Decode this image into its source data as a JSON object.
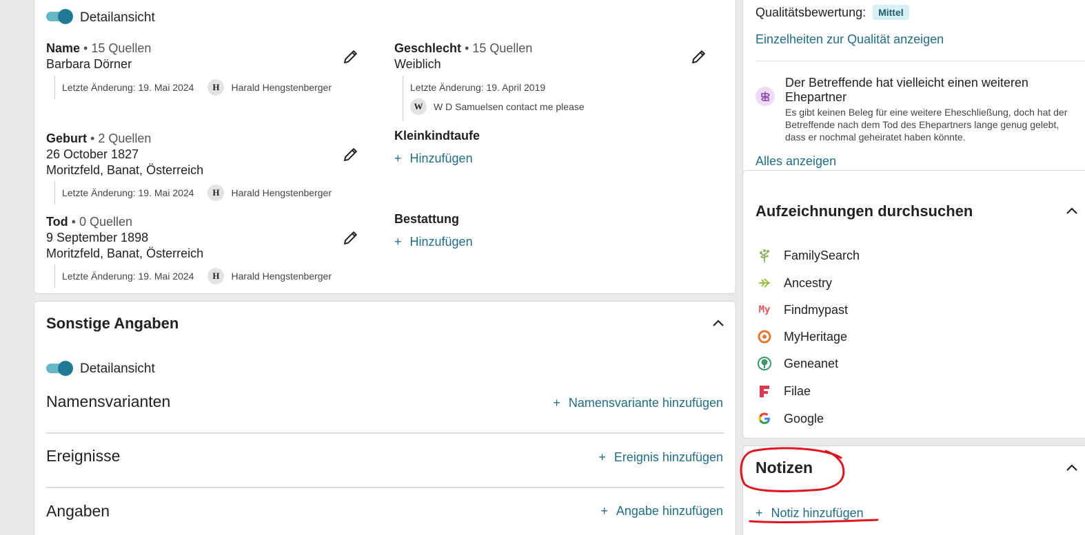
{
  "details": {
    "toggle_label": "Detailansicht",
    "name": {
      "label": "Name",
      "sources": "• 15 Quellen",
      "value": "Barbara Dörner",
      "changed": "Letzte Änderung: 19. Mai 2024",
      "avatar": "H",
      "user": "Harald Hengstenberger"
    },
    "sex": {
      "label": "Geschlecht",
      "sources": "• 15 Quellen",
      "value": "Weiblich",
      "changed": "Letzte Änderung: 19. April 2019",
      "avatar": "W",
      "user": "W D Samuelsen contact me please"
    },
    "birth": {
      "label": "Geburt",
      "sources": "• 2 Quellen",
      "date": "26 October 1827",
      "place": "Moritzfeld, Banat, Österreich",
      "changed": "Letzte Änderung: 19. Mai 2024",
      "avatar": "H",
      "user": "Harald Hengstenberger"
    },
    "christening": {
      "label": "Kleinkindtaufe",
      "add": "Hinzufügen"
    },
    "death": {
      "label": "Tod",
      "sources": "• 0 Quellen",
      "date": "9 September 1898",
      "place": "Moritzfeld, Banat, Österreich",
      "changed": "Letzte Änderung: 19. Mai 2024",
      "avatar": "H",
      "user": "Harald Hengstenberger"
    },
    "burial": {
      "label": "Bestattung",
      "add": "Hinzufügen"
    }
  },
  "other": {
    "title": "Sonstige Angaben",
    "toggle_label": "Detailansicht",
    "rows": [
      {
        "title": "Namensvarianten",
        "action": "Namensvariante hinzufügen"
      },
      {
        "title": "Ereignisse",
        "action": "Ereignis hinzufügen"
      },
      {
        "title": "Angaben",
        "action": "Angabe hinzufügen"
      }
    ]
  },
  "quality": {
    "label": "Qualitätsbewertung:",
    "badge": "Mittel",
    "details_link": "Einzelheiten zur Qualität anzeigen",
    "hint_title": "Der Betreffende hat vielleicht einen weiteren Ehepartner",
    "hint_text": "Es gibt keinen Beleg für eine weitere Eheschließung, doch hat der Betreffende nach dem Tod des Ehepartners lange genug gelebt, dass er nochmal geheiratet haben könnte.",
    "show_all": "Alles anzeigen"
  },
  "search": {
    "title": "Aufzeichnungen durchsuchen",
    "providers": [
      {
        "name": "FamilySearch",
        "icon": "familysearch-tree-icon",
        "color": "#8cb369"
      },
      {
        "name": "Ancestry",
        "icon": "ancestry-leaf-icon",
        "color": "#9cbe3c"
      },
      {
        "name": "Findmypast",
        "icon": "findmypast-icon",
        "color": "#e8545a"
      },
      {
        "name": "MyHeritage",
        "icon": "myheritage-icon",
        "color": "#e8772e"
      },
      {
        "name": "Geneanet",
        "icon": "geneanet-icon",
        "color": "#3a9a6e"
      },
      {
        "name": "Filae",
        "icon": "filae-icon",
        "color": "#e0394b"
      },
      {
        "name": "Google",
        "icon": "google-icon",
        "color": "#4285f4"
      }
    ]
  },
  "notes": {
    "title": "Notizen",
    "add": "Notiz hinzufügen",
    "annotation_color": "#e0141e"
  },
  "colors": {
    "link": "#1f6e88",
    "toggle": "#1f7a96",
    "badge_bg": "#d8f0f5"
  }
}
